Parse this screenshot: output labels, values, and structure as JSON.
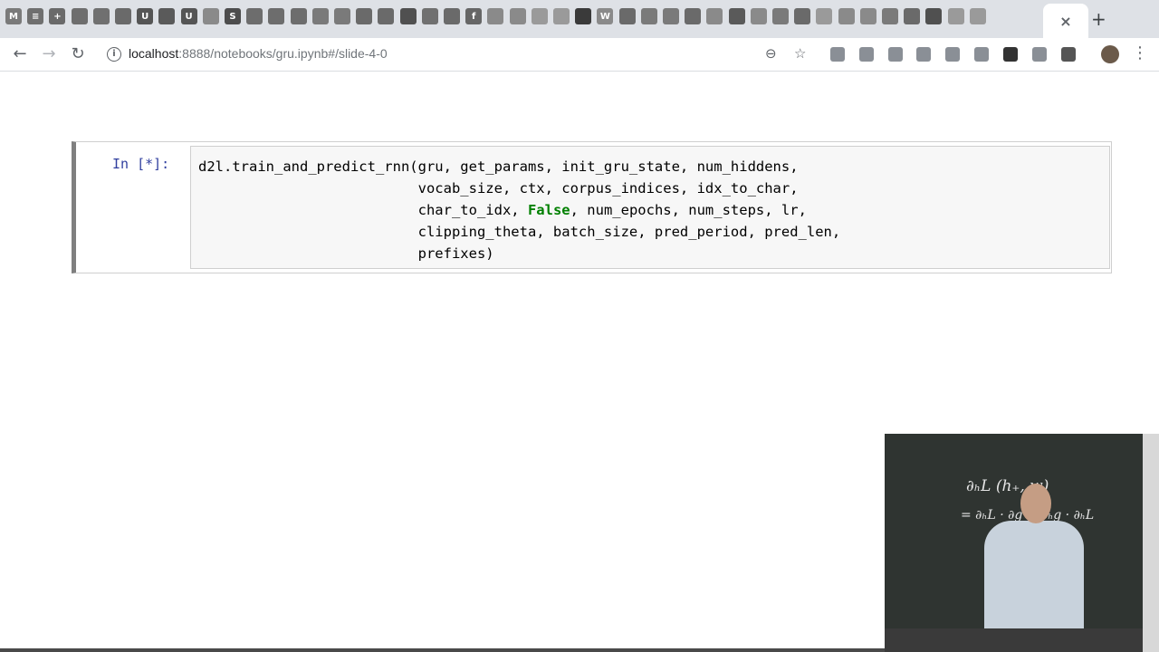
{
  "browser": {
    "tabs": [
      {
        "icon": "M",
        "color": "#7a7a7a"
      },
      {
        "icon": "≡",
        "color": "#6f6f6f"
      },
      {
        "icon": "+",
        "color": "#6a6a6a"
      },
      {
        "icon": "",
        "color": "#6e6e6e"
      },
      {
        "icon": "",
        "color": "#707070"
      },
      {
        "icon": "",
        "color": "#6a6a6a"
      },
      {
        "icon": "U",
        "color": "#555555"
      },
      {
        "icon": "",
        "color": "#5a5a5a"
      },
      {
        "icon": "U",
        "color": "#555555"
      },
      {
        "icon": "",
        "color": "#8a8a8a"
      },
      {
        "icon": "S",
        "color": "#4d4d4d"
      },
      {
        "icon": "",
        "color": "#6d6d6d"
      },
      {
        "icon": "",
        "color": "#6d6d6d"
      },
      {
        "icon": "",
        "color": "#6d6d6d"
      },
      {
        "icon": "",
        "color": "#7a7a7a"
      },
      {
        "icon": "",
        "color": "#7a7a7a"
      },
      {
        "icon": "",
        "color": "#6a6a6a"
      },
      {
        "icon": "",
        "color": "#6a6a6a"
      },
      {
        "icon": "",
        "color": "#505050"
      },
      {
        "icon": "",
        "color": "#707070"
      },
      {
        "icon": "",
        "color": "#6a6a6a"
      },
      {
        "icon": "f",
        "color": "#666666"
      },
      {
        "icon": "",
        "color": "#8a8a8a"
      },
      {
        "icon": "",
        "color": "#8a8a8a"
      },
      {
        "icon": "",
        "color": "#9a9a9a"
      },
      {
        "icon": "",
        "color": "#9a9a9a"
      },
      {
        "icon": "",
        "color": "#3a3a3a"
      },
      {
        "icon": "W",
        "color": "#8a8a8a"
      },
      {
        "icon": "",
        "color": "#6a6a6a"
      },
      {
        "icon": "",
        "color": "#7a7a7a"
      },
      {
        "icon": "",
        "color": "#7a7a7a"
      },
      {
        "icon": "",
        "color": "#6a6a6a"
      },
      {
        "icon": "",
        "color": "#8a8a8a"
      },
      {
        "icon": "",
        "color": "#5a5a5a"
      },
      {
        "icon": "",
        "color": "#8a8a8a"
      },
      {
        "icon": "",
        "color": "#7a7a7a"
      },
      {
        "icon": "",
        "color": "#6a6a6a"
      },
      {
        "icon": "",
        "color": "#9a9a9a"
      },
      {
        "icon": "",
        "color": "#8a8a8a"
      },
      {
        "icon": "",
        "color": "#8a8a8a"
      },
      {
        "icon": "",
        "color": "#7a7a7a"
      },
      {
        "icon": "",
        "color": "#6a6a6a"
      },
      {
        "icon": "",
        "color": "#505050"
      },
      {
        "icon": "",
        "color": "#9a9a9a"
      },
      {
        "icon": "",
        "color": "#9a9a9a"
      }
    ],
    "active_tab_close": "×",
    "new_tab": "+",
    "nav": {
      "back": "←",
      "forward": "→",
      "reload": "↻"
    },
    "url_host": "localhost",
    "url_rest": ":8888/notebooks/gru.ipynb#/slide-4-0",
    "zoom_icon": "⊖",
    "star_icon": "☆",
    "menu_icon": "⋮"
  },
  "cell": {
    "prompt": "In [*]:",
    "code_lines": [
      {
        "pre": "d2l.train_and_predict_rnn(gru, get_params, init_gru_state, num_hiddens,",
        "kw": "",
        "post": ""
      },
      {
        "pre": "                          vocab_size, ctx, corpus_indices, idx_to_char,",
        "kw": "",
        "post": ""
      },
      {
        "pre": "                          char_to_idx, ",
        "kw": "False",
        "post": ", num_epochs, num_steps, lr,"
      },
      {
        "pre": "                          clipping_theta, batch_size, pred_period, pred_len,",
        "kw": "",
        "post": ""
      },
      {
        "pre": "                          prefixes)",
        "kw": "",
        "post": ""
      }
    ]
  },
  "video": {
    "chalk_line_1": "∂ₕL  (h₊, w)",
    "chalk_line_2": "= ∂ₕL · ∂g + ∂ₕg · ∂ₕL"
  }
}
